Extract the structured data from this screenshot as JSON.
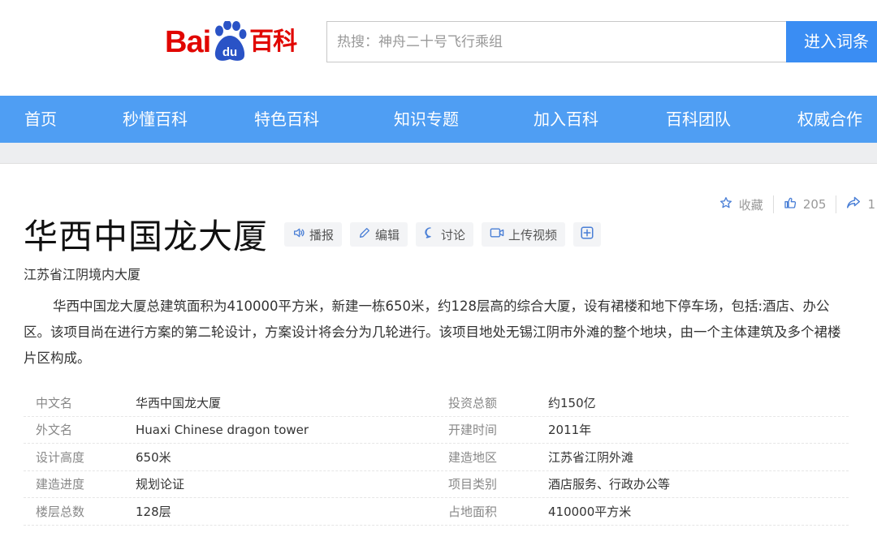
{
  "header": {
    "logo_bai": "Bai",
    "logo_du": "du",
    "logo_baike": "百科",
    "search_placeholder": "热搜：神舟二十号飞行乘组",
    "search_button": "进入词条",
    "brand_red": "#e10601",
    "brand_blue": "#3a8df3"
  },
  "nav": {
    "items": [
      "首页",
      "秒懂百科",
      "特色百科",
      "知识专题",
      "加入百科",
      "百科团队",
      "权威合作"
    ],
    "bg_color": "#4f9ef3"
  },
  "actions": {
    "favorite_label": "收藏",
    "favorite_icon": "star-icon",
    "like_count": "205",
    "like_icon": "thumbs-up-icon",
    "share_count": "1",
    "share_icon": "share-icon"
  },
  "entry": {
    "title": "华西中国龙大厦",
    "subtitle": "江苏省江阴境内大厦",
    "summary": "华西中国龙大厦总建筑面积为410000平方米，新建一栋650米，约128层高的综合大厦，设有裙楼和地下停车场，包括:酒店、办公区。该项目尚在进行方案的第二轮设计，方案设计将会分为几轮进行。该项目地处无锡江阴市外滩的整个地块，由一个主体建筑及多个裙楼片区构成。"
  },
  "tools": [
    {
      "label": "播报",
      "icon": "speaker-icon"
    },
    {
      "label": "编辑",
      "icon": "pencil-icon"
    },
    {
      "label": "讨论",
      "icon": "chat-bubble-icon"
    },
    {
      "label": "上传视频",
      "icon": "video-icon"
    },
    {
      "label": "",
      "icon": "plus-icon"
    }
  ],
  "infobox": [
    {
      "label1": "中文名",
      "value1": "华西中国龙大厦",
      "label2": "投资总额",
      "value2": "约150亿"
    },
    {
      "label1": "外文名",
      "value1": "Huaxi Chinese dragon tower",
      "label2": "开建时间",
      "value2": "2011年"
    },
    {
      "label1": "设计高度",
      "value1": "650米",
      "label2": "建造地区",
      "value2": "江苏省江阴外滩"
    },
    {
      "label1": "建造进度",
      "value1": "规划论证",
      "label2": "项目类别",
      "value2": "酒店服务、行政办公等"
    },
    {
      "label1": "楼层总数",
      "value1": "128层",
      "label2": "占地面积",
      "value2": "410000平方米"
    }
  ]
}
